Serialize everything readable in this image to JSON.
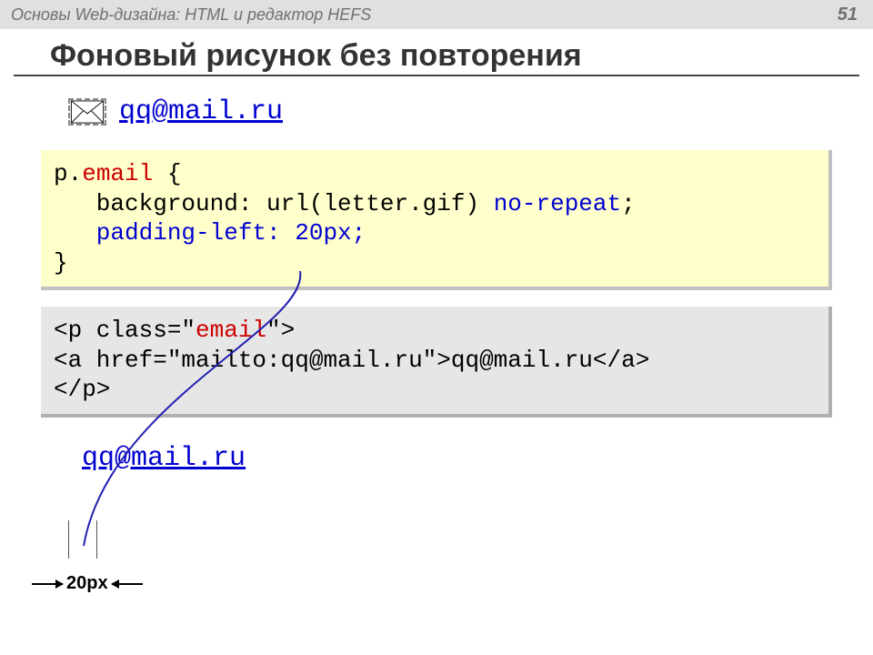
{
  "header": {
    "title": "Основы Web-дизайна: HTML и редактор HEFS",
    "page": "51"
  },
  "slide": {
    "title": "Фоновый рисунок без повторения"
  },
  "email": {
    "text": "qq@mail.ru"
  },
  "css": {
    "sel_p": "p",
    "dot": ".",
    "sel_class": "email",
    "brace_open": " {",
    "line2a": "   background: url(letter.gif) ",
    "line2b": "no-repeat",
    "line2c": ";",
    "line3": "   padding-left: 20px;",
    "brace_close": "}"
  },
  "html": {
    "l1a": "<p class=\"",
    "l1b": "email",
    "l1c": "\">",
    "l2": "<a href=\"mailto:qq@mail.ru\">qq@mail.ru</a>",
    "l3": "</p>"
  },
  "dim": {
    "label": "20px"
  }
}
